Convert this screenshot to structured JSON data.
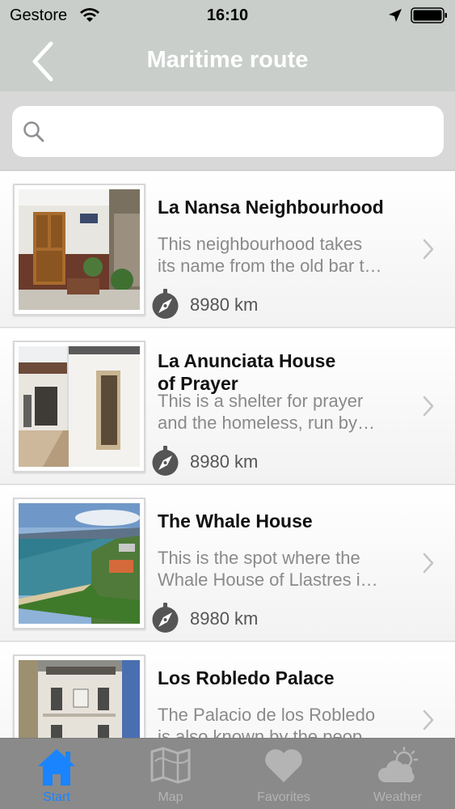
{
  "status_bar": {
    "carrier": "Gestore",
    "time": "16:10",
    "icons": [
      "wifi-icon",
      "location-arrow-icon",
      "battery-icon"
    ]
  },
  "nav": {
    "title": "Maritime route",
    "back_icon": "chevron-left-icon"
  },
  "search": {
    "placeholder": "",
    "value": "",
    "icon": "search-icon"
  },
  "colors": {
    "nav_bar": "#c9ceca",
    "tab_bar": "#8a8a8a",
    "tab_active": "#1a84ff",
    "tab_inactive": "#b4b4b4"
  },
  "places": [
    {
      "title": "La Nansa Neighbourhood",
      "desc_line1": "This neighbourhood takes",
      "desc_line2": "its name from the old bar t…",
      "distance": "8980 km"
    },
    {
      "title_line1": "La Anunciata House",
      "title_line2": "of Prayer",
      "desc_line1": "This is a shelter for prayer",
      "desc_line2": "and the homeless, run by…",
      "distance": "8980 km"
    },
    {
      "title": "The Whale House",
      "desc_line1": "This is the spot where the",
      "desc_line2": "Whale House of Llastres i…",
      "distance": "8980 km"
    },
    {
      "title": "Los Robledo Palace",
      "desc_line1": "The Palacio de los Robledo",
      "desc_line2": "is also known by the peop…",
      "distance": ""
    }
  ],
  "tabs": [
    {
      "label": "Start",
      "icon": "house-icon",
      "active": true
    },
    {
      "label": "Map",
      "icon": "map-icon",
      "active": false
    },
    {
      "label": "Favorites",
      "icon": "heart-icon",
      "active": false
    },
    {
      "label": "Weather",
      "icon": "weather-cloud-sun-icon",
      "active": false
    }
  ]
}
